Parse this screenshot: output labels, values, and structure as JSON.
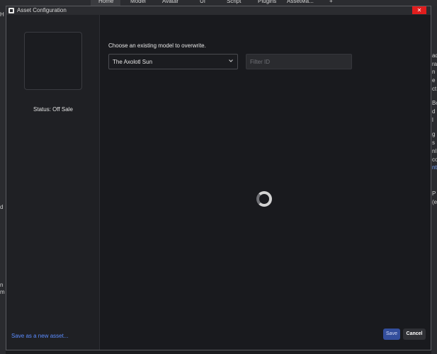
{
  "studio": {
    "tabs": [
      "Home",
      "Model",
      "Avatar",
      "UI",
      "Script",
      "Plugins",
      "AssetMa...",
      "+"
    ],
    "active_tab": "Home",
    "right_fragments": [
      "ad",
      "ra",
      "n",
      "e",
      "ct",
      "Bo",
      "d",
      "l",
      "g",
      "s",
      "nl",
      "co",
      "nt",
      "P",
      "(e"
    ],
    "left_fragments": [
      "H",
      "d",
      "n",
      "m"
    ]
  },
  "dialog": {
    "title": "Asset Configuration",
    "close_label": "✕",
    "status": "Status: Off Sale",
    "prompt": "Choose an existing model to overwrite.",
    "selected_model": "The Axolotl Sun",
    "filter_placeholder": "Filter ID",
    "filter_value": "",
    "save_new_label": "Save as a new asset...",
    "save_label": "Save",
    "cancel_label": "Cancel"
  },
  "colors": {
    "dialog_bg": "#191a1e",
    "sidebar_bg": "#1f2024",
    "accent_blue": "#5b8cff",
    "save_button": "#334e9c",
    "close_red": "#e11d1d"
  },
  "icons": [
    "studio-logo-icon",
    "close-icon",
    "chevron-down-icon",
    "loading-spinner-icon"
  ]
}
